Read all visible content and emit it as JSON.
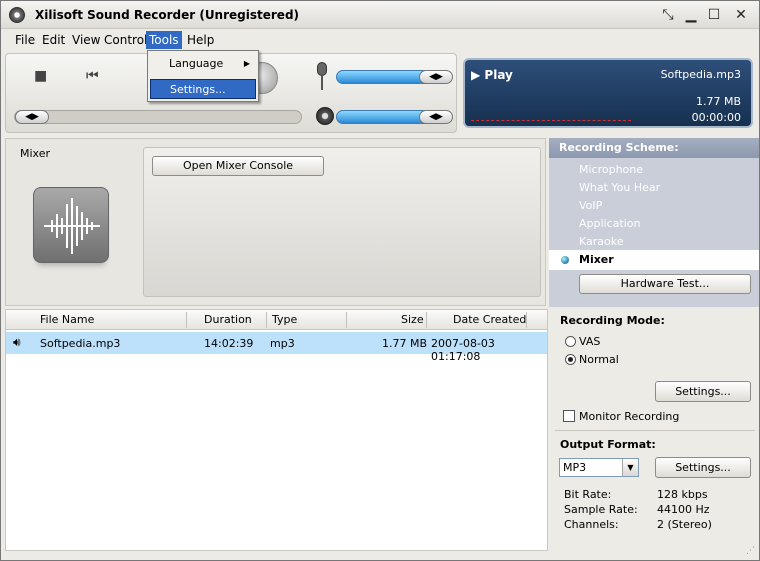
{
  "titlebar": {
    "title": "Xilisoft Sound Recorder (Unregistered)"
  },
  "menu": {
    "file": "File",
    "edit": "Edit",
    "view": "View",
    "control": "Control",
    "tools": "Tools",
    "help": "Help"
  },
  "tools_menu": {
    "language": "Language",
    "settings": "Settings..."
  },
  "display": {
    "status": "Play",
    "file_name": "Softpedia.mp3",
    "size": "1.77 MB",
    "time": "00:00:00"
  },
  "mixer": {
    "label": "Mixer",
    "open_console": "Open Mixer Console"
  },
  "file_list": {
    "columns": [
      "File Name",
      "Duration",
      "Type",
      "Size",
      "Date Created"
    ],
    "rows": [
      {
        "name": "Softpedia.mp3",
        "duration": "14:02:39",
        "type": "mp3",
        "size": "1.77 MB",
        "date": "2007-08-03  01:17:08"
      }
    ]
  },
  "scheme": {
    "title": "Recording Scheme:",
    "items": [
      "Microphone",
      "What You Hear",
      "VoIP",
      "Application",
      "Karaoke"
    ],
    "active": "Mixer",
    "hardware_test": "Hardware Test..."
  },
  "mode": {
    "title": "Recording Mode:",
    "vas": "VAS",
    "normal": "Normal",
    "selected": "Normal",
    "settings": "Settings...",
    "monitor": "Monitor Recording",
    "monitor_checked": false
  },
  "output": {
    "title": "Output Format:",
    "format": "MP3",
    "settings": "Settings...",
    "bit_rate_label": "Bit Rate:",
    "bit_rate": "128 kbps",
    "sample_rate_label": "Sample Rate:",
    "sample_rate": "44100 Hz",
    "channels_label": "Channels:",
    "channels": "2 (Stereo)"
  },
  "sliders": {
    "volume_mic": 0.93,
    "volume_speaker": 0.93,
    "seek": 0.02
  },
  "colors": {
    "accent": "#316ac5",
    "display_bg": "#1f3c61",
    "selected_row": "#bde1fb"
  }
}
